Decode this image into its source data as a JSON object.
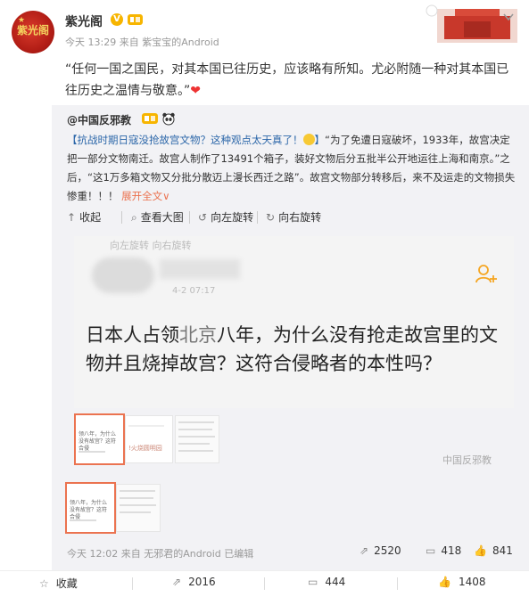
{
  "post": {
    "author": "紫光阁",
    "meta_time": "今天 13:29",
    "meta_from": "来自",
    "meta_source": "紫宝宝的Android",
    "text": "“任何一国之国民，对其本国已往历史，应该略有所知。尤必附随一种对其本国已往历史之温情与敬意。”",
    "avatar_text": "紫光阁"
  },
  "repost": {
    "author": "@中国反邪教",
    "text_tag": "【抗战时期日寇没抢故宫文物？这种观点太天真了！",
    "text_tag_end": "】",
    "text_body": "“为了免遭日寇破坏，1933年，故宫决定把一部分文物南迁。故宫人制作了13491个箱子，装好文物后分五批半公开地运往上海和南京。”之后，“这1万多箱文物又分批分散迈上漫长西迁之路”。故宫文物部分转移后，来不及运走的文物损失惨重！！！",
    "expand_label": "展开全文",
    "expand_caret": "∨"
  },
  "image_toolbar": {
    "collapse": "收起",
    "view_large": "查看大图",
    "rotate_left": "向左旋转",
    "rotate_right": "向右旋转"
  },
  "big_image": {
    "ghost_text": "向左旋转   向右旋转",
    "blur_date": "4-2  07:17",
    "question_a": "日本人占领",
    "question_dim": "北京",
    "question_b": "八年，为什么没有抢走故宫里的文物并且烧掉故宫？这符合侵略者的本性吗？"
  },
  "thumbs": {
    "t1_text": "领八年，为什么没有故宫？这符合侵",
    "t2_text": "!火烧圆明园",
    "t4_text": "领八年，为什么没有故宫？这符合侵"
  },
  "watermark": "中国反邪教",
  "repost_footer": {
    "time": "今天 12:02",
    "from": "来自",
    "source": "无邪君的Android",
    "edited": "已编辑",
    "shares": "2520",
    "comments": "418",
    "likes": "841"
  },
  "bottom_bar": {
    "favorite": "收藏",
    "shares": "2016",
    "comments": "444",
    "likes": "1408"
  },
  "colors": {
    "link": "#eb7350",
    "topic": "#2c67a9",
    "repost_bg": "#f2f2f5",
    "badge_gold": "#f7b500"
  }
}
